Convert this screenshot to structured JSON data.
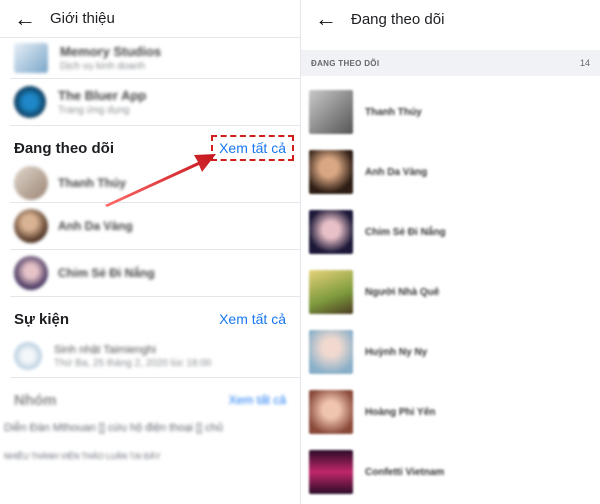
{
  "left": {
    "header": {
      "back_icon": "arrow-left-icon",
      "title": "Giới thiệu"
    },
    "pages": [
      {
        "name": "Memory Studios",
        "sub": "Dịch vụ kinh doanh",
        "color": "#7aa5c9"
      },
      {
        "name": "The Bluer App",
        "sub": "Trang ứng dụng",
        "color": "#0b3a5a"
      }
    ],
    "following": {
      "title": "Đang theo dõi",
      "see_all": "Xem tất cả",
      "people": [
        {
          "name": "Thanh Thúy",
          "color": "#c9b7a7"
        },
        {
          "name": "Anh Da Vàng",
          "color": "#7b5a45"
        },
        {
          "name": "Chim Sẻ Đi Nắng",
          "color": "#6e5c8a"
        }
      ]
    },
    "events": {
      "title": "Sự kiện",
      "see_all": "Xem tất cả",
      "items": [
        {
          "name": "Sinh nhật Taimienghi",
          "sub": "Thứ Ba, 25 tháng 2, 2020 lúc 18:00",
          "color": "#a8c4d9"
        }
      ]
    },
    "groups": {
      "title": "Nhóm",
      "see_all": "Xem tất cả",
      "lines": [
        "Diễn Đàn Mthouan [] cứu hộ điện thoại [] chủ",
        "NHIỀU THÀNH VIÊN THẢO LUẬN TẠI ĐÂY"
      ]
    }
  },
  "right": {
    "header": {
      "back_icon": "arrow-left-icon",
      "title": "Đang theo dõi"
    },
    "list_label": "ĐANG THEO DÕI",
    "count": "14",
    "items": [
      {
        "name": "Thanh Thúy",
        "color": "#8f8f8f"
      },
      {
        "name": "Anh Da Vàng",
        "color": "#5a3d2e"
      },
      {
        "name": "Chim Sẻ Đi Nắng",
        "color": "#3a2f55"
      },
      {
        "name": "Người Nhà Quê",
        "color": "#b79a3d"
      },
      {
        "name": "Huỳnh Ny Ny",
        "color": "#8ab0c9"
      },
      {
        "name": "Hoàng Phi Yến",
        "color": "#c97d6a"
      },
      {
        "name": "Confetti Vietnam",
        "color": "#5a1d4a"
      }
    ]
  },
  "colors": {
    "accent": "#1877f2",
    "highlight": "#d21d1d"
  }
}
